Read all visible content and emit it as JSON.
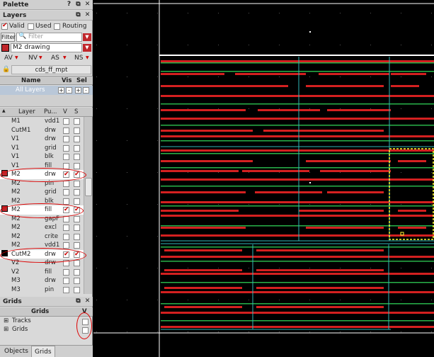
{
  "palette": {
    "title": "Palette"
  },
  "layers_panel": {
    "title": "Layers",
    "filters": [
      {
        "label": "Valid",
        "checked": true
      },
      {
        "label": "Used",
        "checked": false
      },
      {
        "label": "Routing",
        "checked": false
      }
    ],
    "filter_button": "Filter",
    "filter_placeholder": "Filter",
    "current_layer": "M2 drawing",
    "validity_tabs": [
      "AV",
      "NV",
      "AS",
      "NS"
    ],
    "library": "cds_ff_mpt",
    "lpp_headers": {
      "name": "Name",
      "vis": "Vis",
      "sel": "Sel"
    },
    "all_layers": "All Layers",
    "all_layers_buttons": [
      "+",
      "-",
      "+",
      "-"
    ],
    "layer_headers": {
      "layer": "Layer",
      "purpose": "Pu...",
      "v": "V",
      "s": "S"
    },
    "layers": [
      {
        "layer": "M1",
        "purpose": "vdd1",
        "v": false,
        "s": false
      },
      {
        "layer": "CutM1",
        "purpose": "drw",
        "v": false,
        "s": false
      },
      {
        "layer": "V1",
        "purpose": "drw",
        "v": false,
        "s": false
      },
      {
        "layer": "V1",
        "purpose": "grid",
        "v": false,
        "s": false
      },
      {
        "layer": "V1",
        "purpose": "blk",
        "v": false,
        "s": false
      },
      {
        "layer": "V1",
        "purpose": "fill",
        "v": false,
        "s": false
      },
      {
        "layer": "M2",
        "purpose": "drw",
        "v": true,
        "s": true,
        "swatch": "#c0262b"
      },
      {
        "layer": "M2",
        "purpose": "pin",
        "v": false,
        "s": false
      },
      {
        "layer": "M2",
        "purpose": "grid",
        "v": false,
        "s": false
      },
      {
        "layer": "M2",
        "purpose": "blk",
        "v": false,
        "s": false
      },
      {
        "layer": "M2",
        "purpose": "fill",
        "v": true,
        "s": true,
        "swatch": "#c0262b"
      },
      {
        "layer": "M2",
        "purpose": "gapF",
        "v": false,
        "s": false
      },
      {
        "layer": "M2",
        "purpose": "excl",
        "v": false,
        "s": false
      },
      {
        "layer": "M2",
        "purpose": "crite",
        "v": false,
        "s": false
      },
      {
        "layer": "M2",
        "purpose": "vdd1",
        "v": false,
        "s": false
      },
      {
        "layer": "CutM2",
        "purpose": "drw",
        "v": true,
        "s": true,
        "swatch": "#000000"
      },
      {
        "layer": "V2",
        "purpose": "drw",
        "v": false,
        "s": false
      },
      {
        "layer": "V2",
        "purpose": "fill",
        "v": false,
        "s": false
      },
      {
        "layer": "M3",
        "purpose": "drw",
        "v": false,
        "s": false
      },
      {
        "layer": "M3",
        "purpose": "pin",
        "v": false,
        "s": false
      }
    ]
  },
  "grids_panel": {
    "title": "Grids",
    "header": "Grids",
    "v_header": "V",
    "items": [
      {
        "label": "Tracks",
        "checked": false
      },
      {
        "label": "Grids",
        "checked": false
      }
    ]
  },
  "bottom_tabs": [
    "Objects",
    "Grids"
  ],
  "colors": {
    "metal_red": "#d42020",
    "metal_green": "#29b34a",
    "boundary_cyan": "#2fb7b7",
    "highlight_yellow": "#ffff33",
    "annotation_red": "#d00000"
  }
}
